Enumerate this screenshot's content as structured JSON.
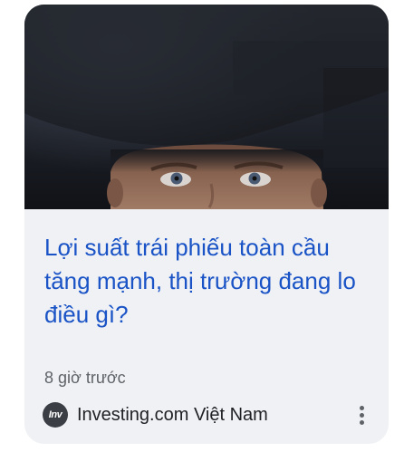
{
  "article": {
    "title": "Lợi suất trái phiếu toàn cầu tăng mạnh, thị trường đang lo điều gì?",
    "time": "8 giờ trước",
    "source": {
      "name": "Investing.com Việt Nam",
      "logo_text": "Inv"
    },
    "image_icon": "man-looking-up-image",
    "more_icon": "more-vertical-icon"
  },
  "colors": {
    "title": "#1a53c6",
    "card_background": "#eff1f5",
    "meta_text": "#5f6368"
  }
}
